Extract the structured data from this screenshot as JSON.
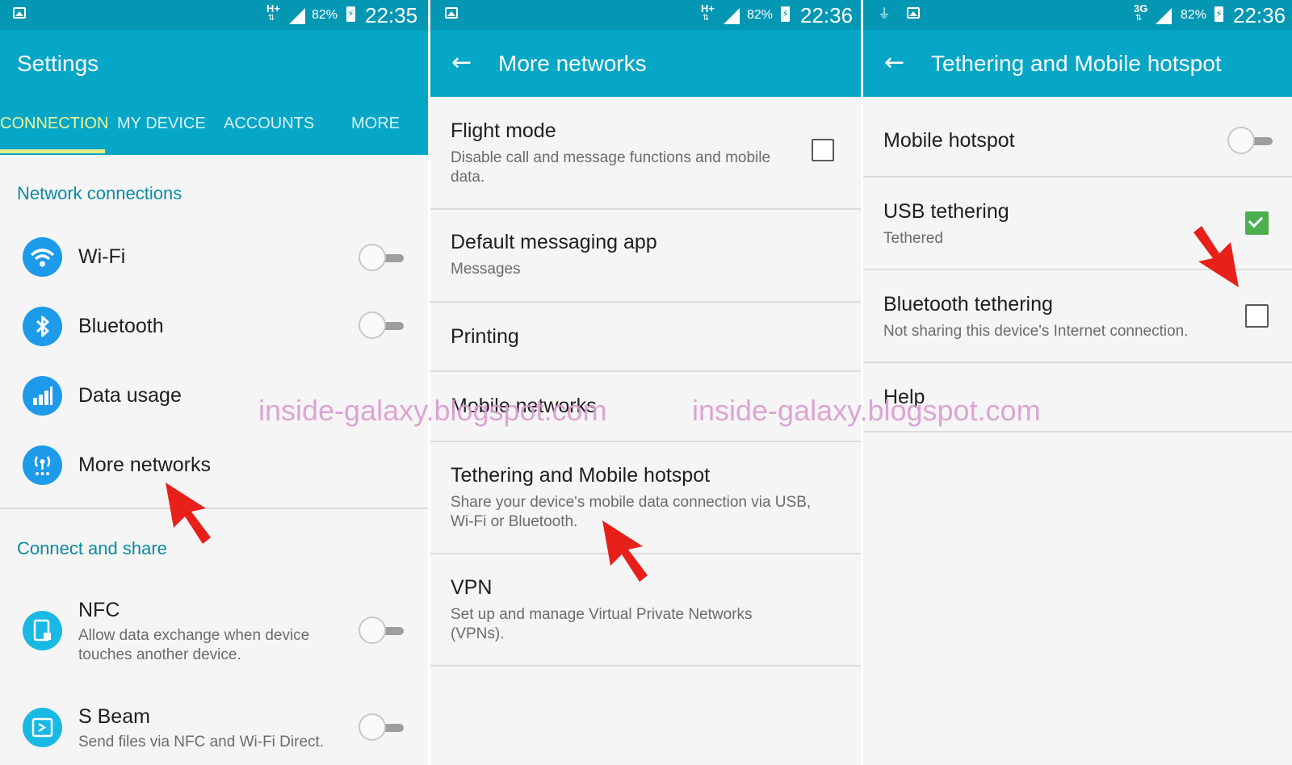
{
  "colors": {
    "status_bar": "#0497b4",
    "app_bar": "#05a6c6",
    "active_tab": "#f0f79a",
    "section_header": "#0a8aa3",
    "checkbox_checked": "#4caf50",
    "pointer": "#e8201a",
    "watermark": "#d99fd1"
  },
  "status": {
    "net_hplus": "H+",
    "net_3g": "3G",
    "net_arrows": "⇅",
    "battery": "82%",
    "time_1": "22:35",
    "time_2": "22:36",
    "time_3": "22:36",
    "icons": [
      "gallery-icon",
      "usb-icon",
      "signal-icon",
      "battery-icon"
    ]
  },
  "settings": {
    "title": "Settings",
    "tabs": [
      "CONNECTION",
      "MY DEVICE",
      "ACCOUNTS",
      "MORE"
    ],
    "active_tab": "CONNECTION",
    "section_network": "Network connections",
    "wifi": {
      "label": "Wi-Fi",
      "icon": "wifi-icon",
      "on": false
    },
    "bluetooth": {
      "label": "Bluetooth",
      "icon": "bluetooth-icon",
      "on": false
    },
    "data_usage": {
      "label": "Data usage",
      "icon": "bar-chart-icon"
    },
    "more_networks": {
      "label": "More networks",
      "icon": "antenna-icon"
    },
    "section_share": "Connect and share",
    "nfc": {
      "label": "NFC",
      "description": "Allow data exchange when device touches another device.",
      "icon": "nfc-icon",
      "on": false
    },
    "sbeam": {
      "label": "S Beam",
      "description": "Send files via NFC and Wi-Fi Direct.",
      "icon": "s-beam-icon",
      "on": false
    }
  },
  "more_networks": {
    "title": "More networks",
    "flight_mode": {
      "label": "Flight mode",
      "description": "Disable call and message functions and mobile data.",
      "checked": false
    },
    "default_messaging": {
      "label": "Default messaging app",
      "value": "Messages"
    },
    "printing": {
      "label": "Printing"
    },
    "mobile_networks": {
      "label": "Mobile networks"
    },
    "tethering": {
      "label": "Tethering and Mobile hotspot",
      "description": "Share your device's mobile data connection via USB, Wi-Fi or Bluetooth."
    },
    "vpn": {
      "label": "VPN",
      "description": "Set up and manage Virtual Private Networks (VPNs)."
    }
  },
  "tethering": {
    "title": "Tethering and Mobile hotspot",
    "mobile_hotspot": {
      "label": "Mobile hotspot",
      "on": false
    },
    "usb_tethering": {
      "label": "USB tethering",
      "status": "Tethered",
      "checked": true
    },
    "bluetooth_tethering": {
      "label": "Bluetooth tethering",
      "status": "Not sharing this device's Internet connection.",
      "checked": false
    },
    "help": {
      "label": "Help"
    }
  },
  "watermark": "inside-galaxy.blogspot.com"
}
